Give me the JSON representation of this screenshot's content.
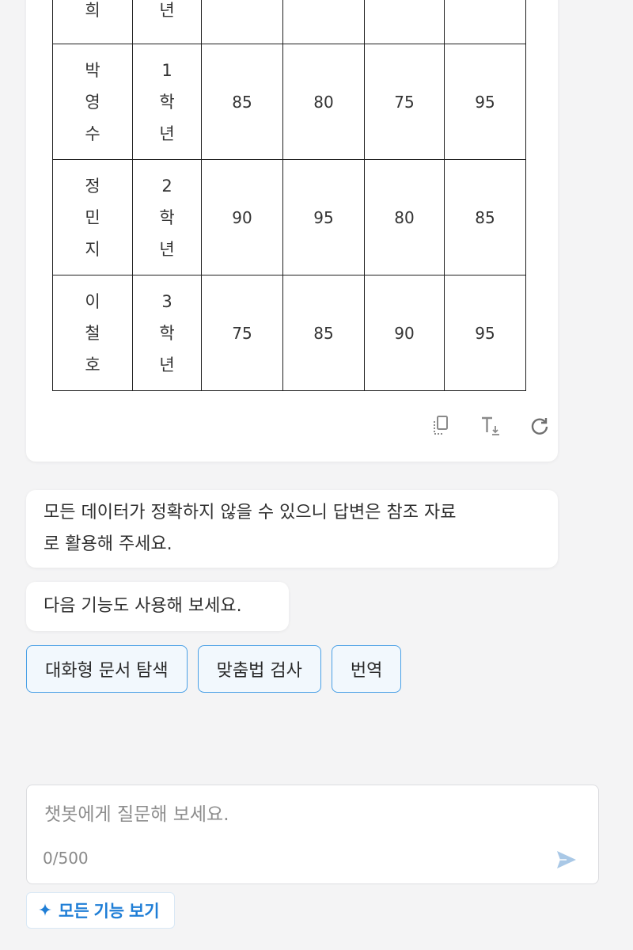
{
  "table": {
    "rows": [
      {
        "name": "희",
        "grade": "년",
        "scores": [
          "",
          "",
          "",
          ""
        ]
      },
      {
        "name": "박\n영\n수",
        "grade": "1\n학\n년",
        "scores": [
          "85",
          "80",
          "75",
          "95"
        ]
      },
      {
        "name": "정\n민\n지",
        "grade": "2\n학\n년",
        "scores": [
          "90",
          "95",
          "80",
          "85"
        ]
      },
      {
        "name": "이\n철\n호",
        "grade": "3\n학\n년",
        "scores": [
          "75",
          "85",
          "90",
          "95"
        ]
      }
    ]
  },
  "card_actions": {
    "icons": [
      "copy-icon",
      "text-size-icon",
      "refresh-icon"
    ]
  },
  "notice": {
    "line1": "모든 데이터가 정확하지 않을 수 있으니 답변은 참조 자료",
    "line2": "로 활용해 주세요."
  },
  "features_message": "다음 기능도 사용해 보세요.",
  "feature_chips": [
    "대화형 문서 탐색",
    "맞춤법 검사",
    "번역"
  ],
  "composer": {
    "placeholder": "챗봇에게 질문해 보세요.",
    "value": "",
    "counter": "0/500",
    "send_icon": "send-icon"
  },
  "all_features_button": {
    "label": "모든 기능 보기",
    "icon": "plus-icon"
  },
  "colors": {
    "accent": "#1f7ed6",
    "chip_border": "#4aa0e6",
    "background": "#f4f4f5"
  }
}
